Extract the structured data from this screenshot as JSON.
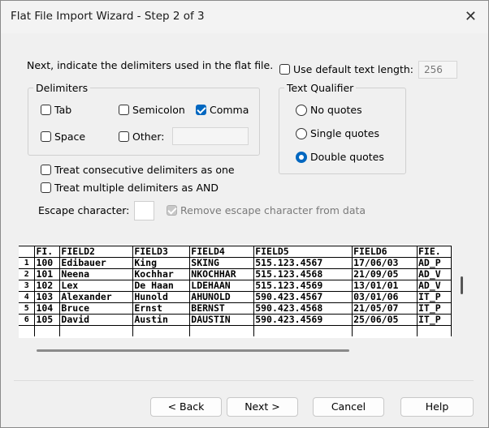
{
  "window": {
    "title": "Flat File Import Wizard - Step 2 of 3",
    "close_glyph": "✕"
  },
  "instruction": "Next, indicate the delimiters used in the flat file.",
  "default_text_length": {
    "label": "Use default text length:",
    "checked": false,
    "value": "256"
  },
  "delimiters": {
    "title": "Delimiters",
    "tab": "Tab",
    "semicolon": "Semicolon",
    "comma": "Comma",
    "space": "Space",
    "other": "Other:",
    "other_value": "",
    "checked": [
      "comma"
    ]
  },
  "text_qualifier": {
    "title": "Text Qualifier",
    "options": [
      "No quotes",
      "Single quotes",
      "Double quotes"
    ],
    "selected": "Double quotes"
  },
  "options": {
    "consecutive": "Treat consecutive delimiters as one",
    "multiple_and": "Treat multiple delimiters as AND",
    "escape_label": "Escape character:",
    "escape_value": "",
    "remove_escape": "Remove escape character from data"
  },
  "preview": {
    "headers": [
      "FI.",
      "FIELD2",
      "FIELD3",
      "FIELD4",
      "FIELD5",
      "FIELD6",
      "FIE."
    ],
    "rows": [
      [
        "1",
        "100",
        "Edibauer",
        "King",
        "SKING",
        "515.123.4567",
        "17/06/03",
        "AD_P"
      ],
      [
        "2",
        "101",
        "Neena",
        "Kochhar",
        "NKOCHHAR",
        "515.123.4568",
        "21/09/05",
        "AD_V"
      ],
      [
        "3",
        "102",
        "Lex",
        "De Haan",
        "LDEHAAN",
        "515.123.4569",
        "13/01/01",
        "AD_V"
      ],
      [
        "4",
        "103",
        "Alexander",
        "Hunold",
        "AHUNOLD",
        "590.423.4567",
        "03/01/06",
        "IT_P"
      ],
      [
        "5",
        "104",
        "Bruce",
        "Ernst",
        "BERNST",
        "590.423.4568",
        "21/05/07",
        "IT_P"
      ],
      [
        "6",
        "105",
        "David",
        "Austin",
        "DAUSTIN",
        "590.423.4569",
        "25/06/05",
        "IT_P"
      ]
    ]
  },
  "buttons": {
    "back": "< Back",
    "next": "Next >",
    "cancel": "Cancel",
    "help": "Help"
  },
  "colors": {
    "accent": "#0067c0"
  }
}
